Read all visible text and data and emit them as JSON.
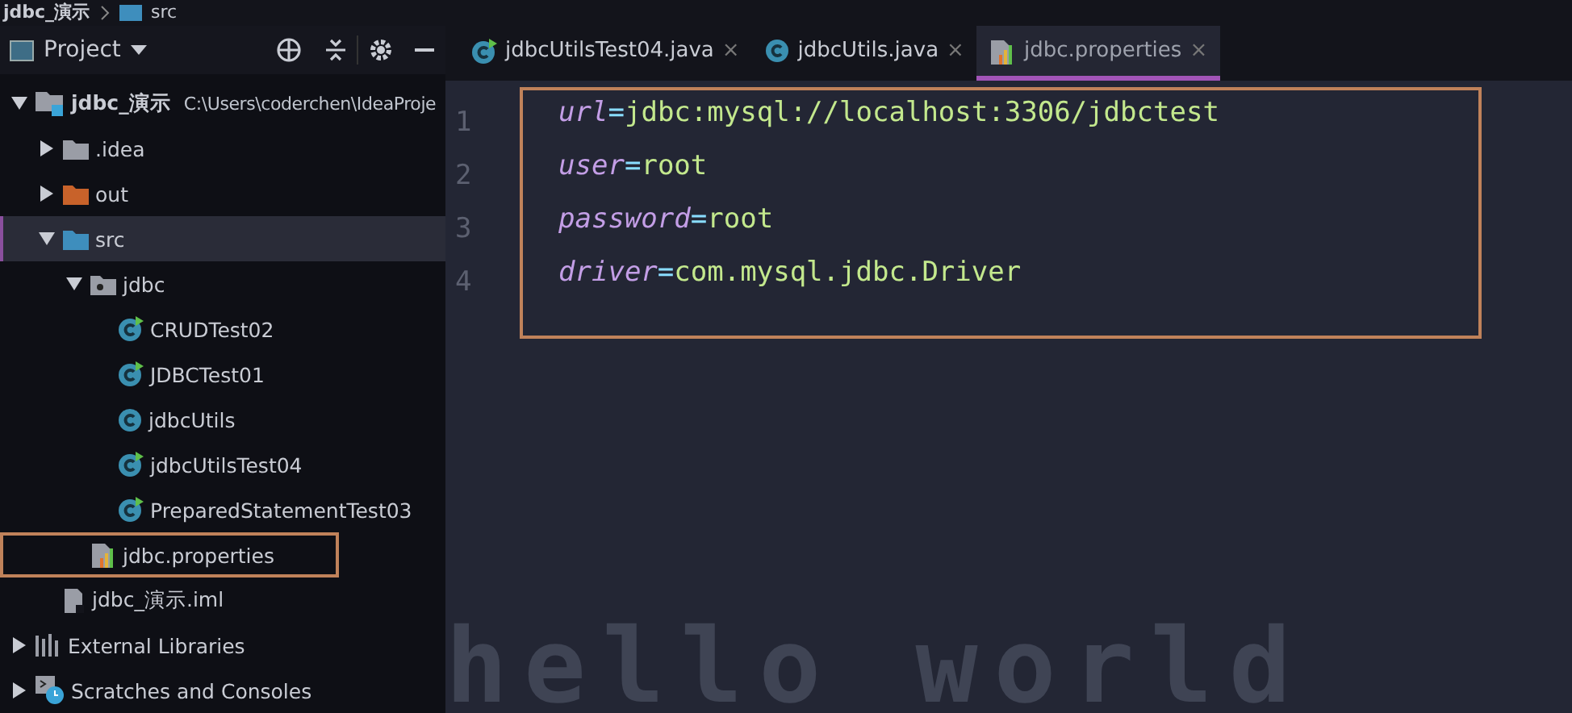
{
  "breadcrumb": [
    "jdbc_演示",
    "src"
  ],
  "project_panel": {
    "title": "Project",
    "tree": [
      {
        "label": "jdbc_演示",
        "kind": "module",
        "path": "C:\\Users\\coderchen\\IdeaProje",
        "expanded": true,
        "selected": false,
        "annotated": false,
        "children": [
          {
            "label": ".idea",
            "kind": "folder",
            "expanded": false,
            "selected": false,
            "annotated": false
          },
          {
            "label": "out",
            "kind": "excluded-folder",
            "expanded": false,
            "selected": false,
            "annotated": false
          },
          {
            "label": "src",
            "kind": "source-folder",
            "expanded": true,
            "selected": true,
            "annotated": false,
            "children": [
              {
                "label": "jdbc",
                "kind": "package",
                "expanded": true,
                "selected": false,
                "annotated": false,
                "children": [
                  {
                    "label": "CRUDTest02",
                    "kind": "runnable-class",
                    "selected": false,
                    "annotated": false
                  },
                  {
                    "label": "JDBCTest01",
                    "kind": "runnable-class",
                    "selected": false,
                    "annotated": false
                  },
                  {
                    "label": "jdbcUtils",
                    "kind": "class",
                    "selected": false,
                    "annotated": false
                  },
                  {
                    "label": "jdbcUtilsTest04",
                    "kind": "runnable-class",
                    "selected": false,
                    "annotated": false
                  },
                  {
                    "label": "PreparedStatementTest03",
                    "kind": "runnable-class",
                    "selected": false,
                    "annotated": false
                  }
                ]
              },
              {
                "label": "jdbc.properties",
                "kind": "properties",
                "selected": false,
                "annotated": true
              }
            ]
          },
          {
            "label": "jdbc_演示.iml",
            "kind": "iml",
            "selected": false,
            "annotated": false
          }
        ]
      },
      {
        "label": "External Libraries",
        "kind": "libraries",
        "expanded": false,
        "selected": false,
        "annotated": false
      },
      {
        "label": "Scratches and Consoles",
        "kind": "scratches",
        "expanded": false,
        "selected": false,
        "annotated": false
      }
    ]
  },
  "tabs": [
    {
      "label": "jdbcUtilsTest04.java",
      "kind": "runnable-class",
      "close": "×",
      "selected": false
    },
    {
      "label": "jdbcUtils.java",
      "kind": "class",
      "close": "×",
      "selected": false
    },
    {
      "label": "jdbc.properties",
      "kind": "properties",
      "close": "×",
      "selected": true
    }
  ],
  "editor": {
    "annotated": true,
    "lines": [
      {
        "number": "1",
        "key": "url",
        "separator": "=",
        "value": "jdbc:mysql://localhost:3306/jdbctest"
      },
      {
        "number": "2",
        "key": "user",
        "separator": "=",
        "value": "root"
      },
      {
        "number": "3",
        "key": "password",
        "separator": "=",
        "value": "root"
      },
      {
        "number": "4",
        "key": "driver",
        "separator": "=",
        "value": "com.mysql.jdbc.Driver"
      }
    ],
    "background_text": "hello world"
  }
}
